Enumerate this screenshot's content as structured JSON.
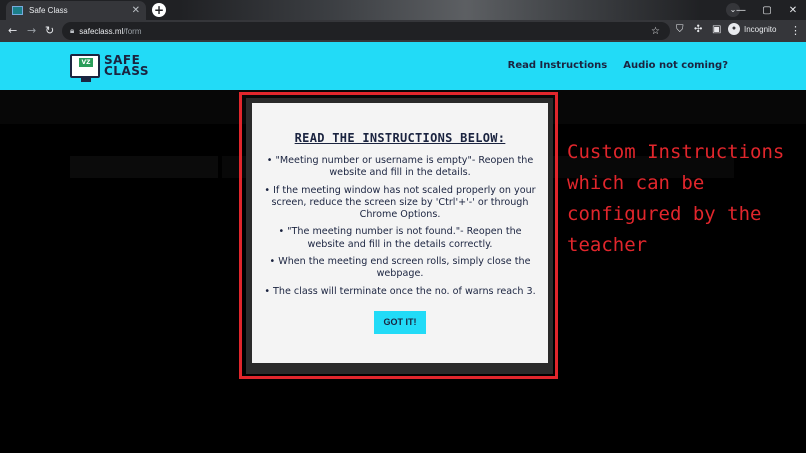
{
  "browser": {
    "tab_title": "Safe Class",
    "tab_close": "✕",
    "new_tab": "+",
    "controls": {
      "minimize": "—",
      "maximize": "▢",
      "close": "✕"
    },
    "url_domain": "safeclass.ml",
    "url_path": "/form",
    "incognito_label": "Incognito",
    "icons": [
      "back-icon",
      "forward-icon",
      "reload-icon",
      "lock-icon",
      "star-icon",
      "shield-icon",
      "puzzle-icon",
      "sidepanel-icon",
      "incognito-icon",
      "kebab-icon"
    ]
  },
  "site": {
    "logo_line1": "SAFE",
    "logo_line2": "CLASS",
    "logo_badge": "VZ",
    "nav": [
      "Read Instructions",
      "Audio not coming?"
    ]
  },
  "modal": {
    "title": "READ THE INSTRUCTIONS BELOW:",
    "items": [
      "• \"Meeting number or username is empty\"- Reopen the website and fill in the details.",
      "• If the meeting window has not scaled properly on your screen, reduce the screen size by 'Ctrl'+'-' or through Chrome Options.",
      "• \"The meeting number is not found.\"- Reopen the website and fill in the details correctly.",
      "• When the meeting end screen rolls, simply close the webpage.",
      "• The class will terminate once the no. of warns reach 3."
    ],
    "button": "GOT IT!"
  },
  "annotation": {
    "lines": [
      "Custom Instructions",
      "which can be",
      "configured by the",
      "teacher"
    ]
  },
  "colors": {
    "accent": "#22dbf7",
    "annotation_red": "#e1262c",
    "navy": "#1b2440"
  }
}
